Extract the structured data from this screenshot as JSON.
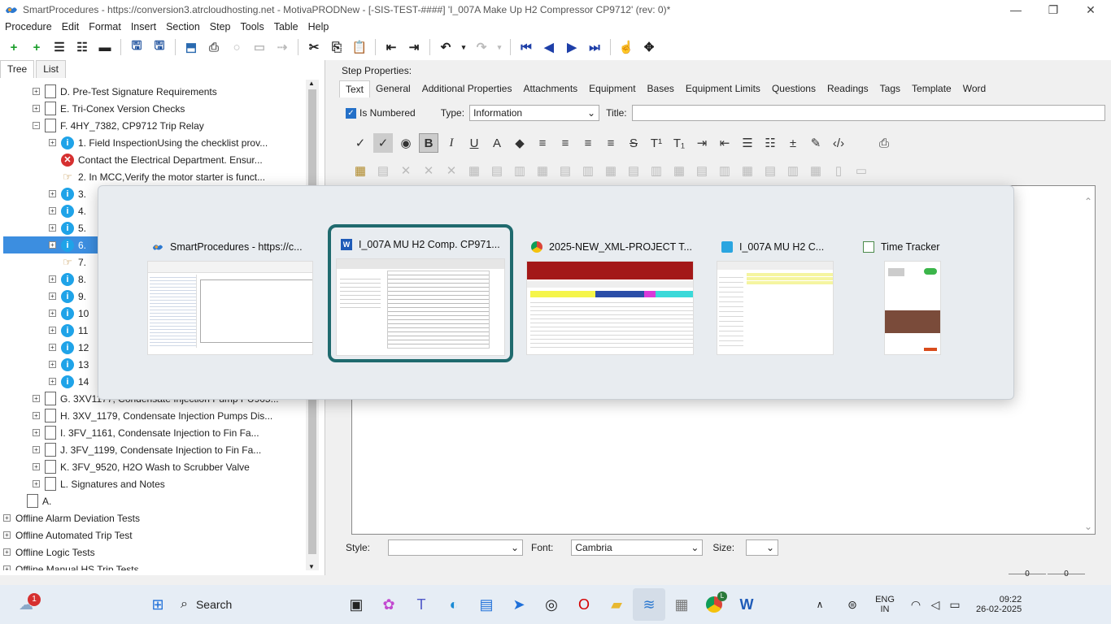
{
  "window": {
    "title": "SmartProcedures - https://conversion3.atrcloudhosting.net - MotivaPRODNew - [-SIS-TEST-####] 'I_007A Make Up H2 Compressor CP9712' (rev: 0)*"
  },
  "menu": [
    "Procedure",
    "Edit",
    "Format",
    "Insert",
    "Section",
    "Step",
    "Tools",
    "Table",
    "Help"
  ],
  "left_tabs": [
    "Tree",
    "List"
  ],
  "tree": [
    {
      "label": "D. Pre-Test Signature Requirements",
      "icon": "doc-icon",
      "level": 1
    },
    {
      "label": "E. Tri-Conex Version Checks",
      "icon": "doc-icon",
      "level": 1
    },
    {
      "label": "F. 4HY_7382, CP9712 Trip Relay",
      "icon": "doc-icon",
      "level": 1
    },
    {
      "label": "1. Field InspectionUsing the checklist prov...",
      "icon": "info-icon",
      "level": 2
    },
    {
      "label": "Contact the Electrical Department. Ensur...",
      "icon": "error-icon",
      "level": 2
    },
    {
      "label": "2. In MCC,Verify the motor starter is funct...",
      "icon": "hand-icon",
      "level": 2
    },
    {
      "label": "3.",
      "icon": "info-icon",
      "level": 2
    },
    {
      "label": "4.",
      "icon": "info-icon",
      "level": 2
    },
    {
      "label": "5.",
      "icon": "info-icon",
      "level": 2
    },
    {
      "label": "6.",
      "icon": "info-icon",
      "level": 2
    },
    {
      "label": "7.",
      "icon": "hand-icon",
      "level": 2
    },
    {
      "label": "8.",
      "icon": "info-icon",
      "level": 2
    },
    {
      "label": "9.",
      "icon": "info-icon",
      "level": 2
    },
    {
      "label": "10",
      "icon": "info-icon",
      "level": 2
    },
    {
      "label": "11",
      "icon": "info-icon",
      "level": 2
    },
    {
      "label": "12",
      "icon": "info-icon",
      "level": 2
    },
    {
      "label": "13",
      "icon": "info-icon",
      "level": 2
    },
    {
      "label": "14",
      "icon": "info-icon",
      "level": 2
    },
    {
      "label": "G. 3XV1177, Condensate Injection Pump PU905...",
      "icon": "doc-icon",
      "level": 1
    },
    {
      "label": "H. 3XV_1179, Condensate Injection Pumps Dis...",
      "icon": "doc-icon",
      "level": 1
    },
    {
      "label": "I. 3FV_1161, Condensate Injection to Fin Fa...",
      "icon": "doc-icon",
      "level": 1
    },
    {
      "label": "J. 3FV_1199, Condensate Injection to Fin Fa...",
      "icon": "doc-icon",
      "level": 1
    },
    {
      "label": "K. 3FV_9520, H2O Wash to Scrubber Valve",
      "icon": "doc-icon",
      "level": 1
    },
    {
      "label": "L. Signatures and Notes",
      "icon": "doc-icon",
      "level": 1
    },
    {
      "label": "A.",
      "icon": "doc-icon",
      "level": 0
    },
    {
      "label": "Offline Alarm Deviation Tests",
      "icon": "none",
      "level": -1
    },
    {
      "label": "Offline Automated Trip Test",
      "icon": "none",
      "level": -1
    },
    {
      "label": "Offline Logic Tests",
      "icon": "none",
      "level": -1
    },
    {
      "label": "Offline Manual HS Trip Tests",
      "icon": "none",
      "level": -1
    }
  ],
  "step_properties": {
    "heading": "Step Properties:",
    "tabs": [
      "Text",
      "General",
      "Additional Properties",
      "Attachments",
      "Equipment",
      "Bases",
      "Equipment Limits",
      "Questions",
      "Readings",
      "Tags",
      "Template",
      "Word"
    ],
    "is_numbered": "Is Numbered",
    "type_label": "Type:",
    "type_value": "Information",
    "title_label": "Title:",
    "style_label": "Style:",
    "font_label": "Font:",
    "font_value": "Cambria",
    "size_label": "Size:",
    "status_a": "0",
    "status_b": "0"
  },
  "switcher": {
    "windows": [
      {
        "title": "SmartProcedures - https://c...",
        "icon": "smartprocedures-icon"
      },
      {
        "title": "I_007A MU H2 Comp. CP971...",
        "icon": "word-icon"
      },
      {
        "title": "2025-NEW_XML-PROJECT T...",
        "icon": "chrome-icon"
      },
      {
        "title": "I_007A MU H2 C...",
        "icon": "app-icon"
      },
      {
        "title": "Time Tracker",
        "icon": "time-tracker-icon"
      }
    ]
  },
  "taskbar": {
    "search": "Search",
    "lang_top": "ENG",
    "lang_bottom": "IN",
    "time": "09:22",
    "date": "26-02-2025",
    "badge": "1",
    "chrome_badge": "L"
  }
}
